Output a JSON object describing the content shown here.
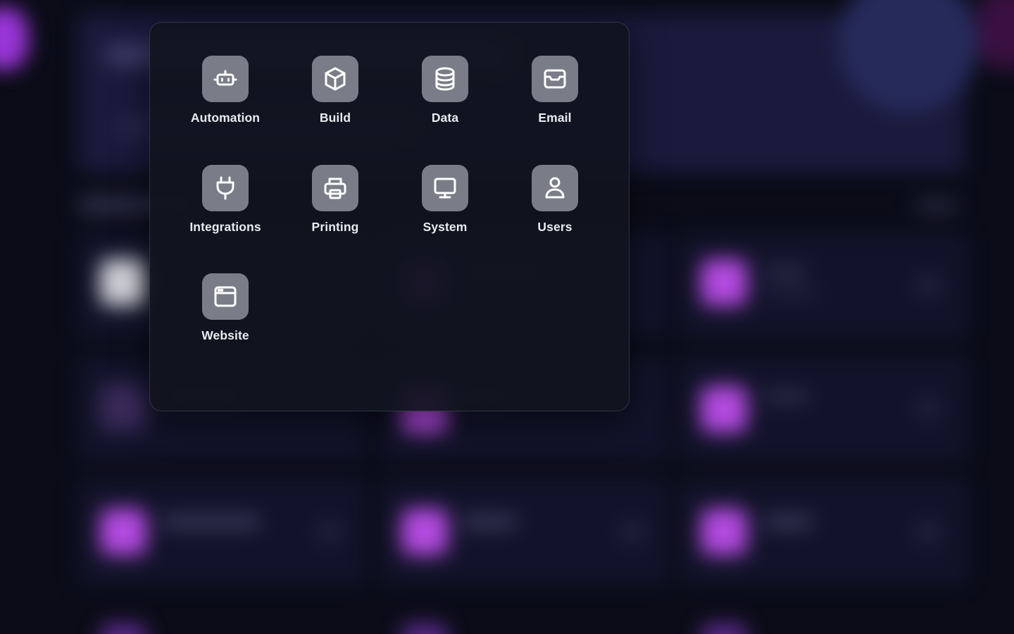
{
  "launcher": {
    "apps": [
      {
        "label": "Automation",
        "icon": "robot-icon"
      },
      {
        "label": "Build",
        "icon": "box-icon"
      },
      {
        "label": "Data",
        "icon": "database-icon"
      },
      {
        "label": "Email",
        "icon": "inbox-icon"
      },
      {
        "label": "Integrations",
        "icon": "plug-icon"
      },
      {
        "label": "Printing",
        "icon": "printer-icon"
      },
      {
        "label": "System",
        "icon": "monitor-icon"
      },
      {
        "label": "Users",
        "icon": "user-icon"
      },
      {
        "label": "Website",
        "icon": "browser-window-icon"
      }
    ]
  },
  "colors": {
    "icon_tile": "#7a7d87",
    "label_text": "#e9ebf0",
    "accent_purple": "#b050e8",
    "background": "#0b0c18"
  }
}
